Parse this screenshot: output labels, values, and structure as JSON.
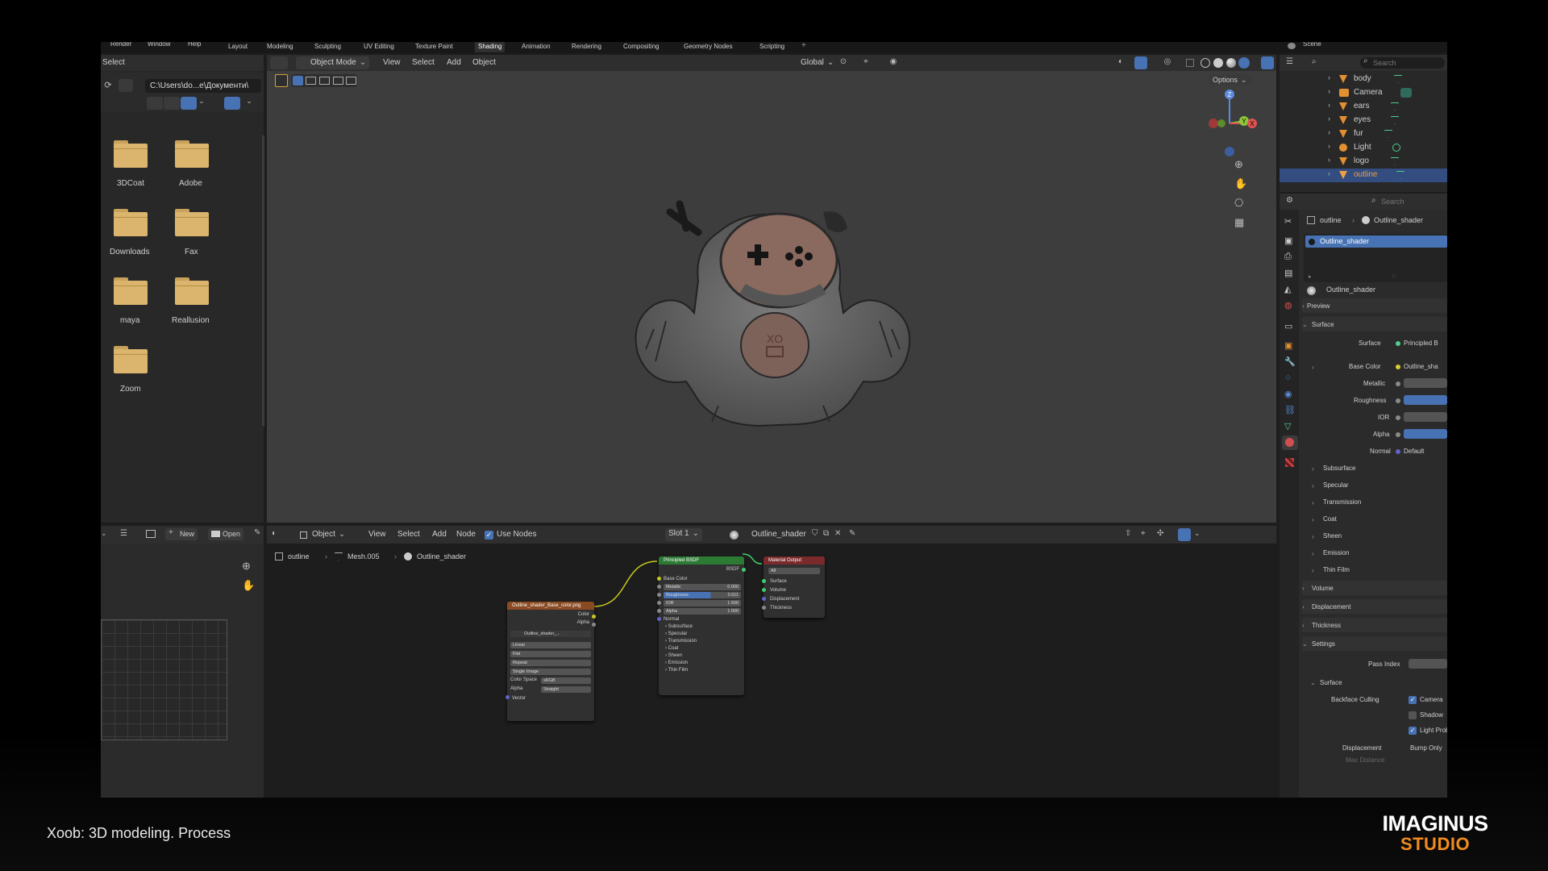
{
  "menu": {
    "items": [
      "Render",
      "Window",
      "Help"
    ]
  },
  "workspace_tabs": [
    "Layout",
    "Modeling",
    "Sculpting",
    "UV Editing",
    "Texture Paint",
    "Shading",
    "Animation",
    "Rendering",
    "Compositing",
    "Geometry Nodes",
    "Scripting"
  ],
  "workspace_active": "Shading",
  "add_tab": "+",
  "scene_label": "Scene",
  "file_browser": {
    "header": "Select",
    "path": "C:\\Users\\do...e\\Документи\\",
    "folders": [
      "3DCoat",
      "Adobe",
      "Downloads",
      "Fax",
      "maya",
      "Reallusion",
      "Zoom"
    ]
  },
  "viewport": {
    "mode": "Object Mode",
    "menus": [
      "View",
      "Select",
      "Add",
      "Object"
    ],
    "transform": "Global",
    "options": "Options"
  },
  "gizmo": {
    "z": "Z",
    "y": "Y",
    "x": "X"
  },
  "outliner": {
    "search_placeholder": "Search",
    "items": [
      "body",
      "Camera",
      "ears",
      "eyes",
      "fur",
      "Light",
      "logo",
      "outline"
    ],
    "selected": "outline"
  },
  "properties": {
    "search_placeholder": "Search",
    "breadcrumb": [
      "outline",
      "Outline_shader"
    ],
    "slot": "Outline_shader",
    "material_name": "Outline_shader",
    "sections": {
      "preview": "Preview",
      "surface": "Surface",
      "subsurface": "Subsurface",
      "specular": "Specular",
      "transmission": "Transmission",
      "coat": "Coat",
      "sheen": "Sheen",
      "emission": "Emission",
      "thin_film": "Thin Film",
      "volume": "Volume",
      "displacement": "Displacement",
      "thickness": "Thickness",
      "settings": "Settings",
      "settings_surface": "Surface"
    },
    "surface_label": "Surface",
    "surface_value": "Principled B",
    "base_color_label": "Base Color",
    "base_color_value": "Outline_sha",
    "metallic_label": "Metallic",
    "roughness_label": "Roughness",
    "ior_label": "IOR",
    "alpha_label": "Alpha",
    "normal_label": "Normal",
    "normal_value": "Default",
    "pass_index_label": "Pass Index",
    "backface_label": "Backface Culling",
    "camera_label": "Camera",
    "shadow_label": "Shadow",
    "light_probe_label": "Light Probe",
    "displacement_label": "Displacement",
    "displacement_value": "Bump Only",
    "max_distance_label": "Max Distance"
  },
  "image_editor": {
    "new": "New",
    "open": "Open"
  },
  "node_editor": {
    "object": "Object",
    "menus": [
      "View",
      "Select",
      "Add",
      "Node"
    ],
    "use_nodes": "Use Nodes",
    "slot": "Slot 1",
    "material": "Outline_shader",
    "breadcrumb": [
      "outline",
      "Mesh.005",
      "Outline_shader"
    ]
  },
  "nodes": {
    "image": {
      "title": "Outline_shader_Base_color.png",
      "out_color": "Color",
      "out_alpha": "Alpha",
      "file": "Outline_shader_...",
      "interp": "Linear",
      "proj": "Flat",
      "ext": "Repeat",
      "source": "Single Image",
      "cs_label": "Color Space",
      "cs": "sRGB",
      "alpha_label": "Alpha",
      "alpha": "Straight",
      "vector": "Vector"
    },
    "bsdf": {
      "title": "Principled BSDF",
      "out": "BSDF",
      "base_color": "Base Color",
      "metallic": "Metallic",
      "metallic_val": "0.000",
      "roughness": "Roughness",
      "roughness_val": "0.611",
      "ior": "IOR",
      "ior_val": "1.500",
      "alpha": "Alpha",
      "alpha_val": "1.000",
      "normal": "Normal",
      "panels": [
        "Subsurface",
        "Specular",
        "Transmission",
        "Coat",
        "Sheen",
        "Emission",
        "Thin Film"
      ]
    },
    "output": {
      "title": "Material Output",
      "target": "All",
      "inputs": [
        "Surface",
        "Volume",
        "Displacement",
        "Thickness"
      ]
    }
  },
  "caption": "Xoob: 3D modeling. Process",
  "logo": {
    "line1": "IMAGINUS",
    "line2": "STUDIO"
  },
  "colors": {
    "accent": "#4772b3",
    "logo_orange": "#f28b1e"
  }
}
